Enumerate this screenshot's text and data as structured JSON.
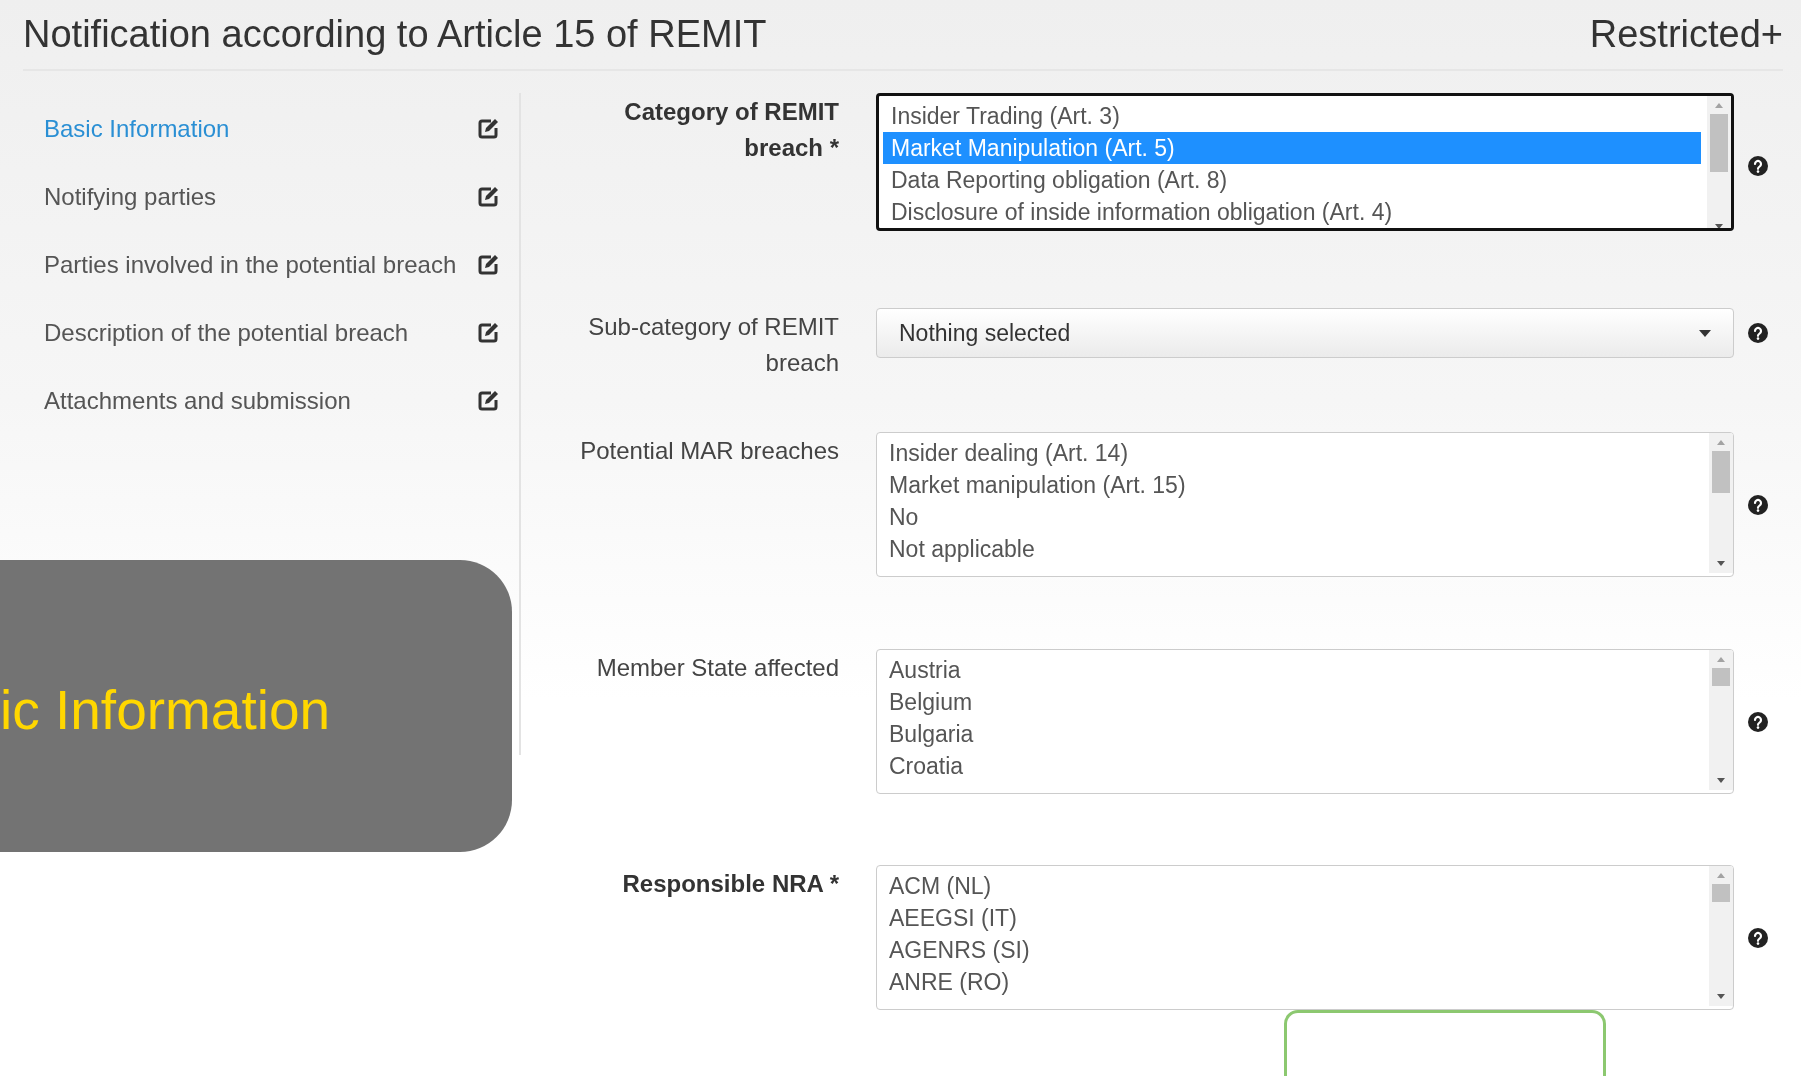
{
  "header": {
    "title": "Notification according to Article 15 of REMIT",
    "badge": "Restricted+"
  },
  "sidebar": {
    "items": [
      {
        "label": "Basic Information",
        "selected": true
      },
      {
        "label": "Notifying parties",
        "selected": false
      },
      {
        "label": "Parties involved in the potential breach",
        "selected": false
      },
      {
        "label": "Description of the potential breach",
        "selected": false
      },
      {
        "label": "Attachments and submission",
        "selected": false
      }
    ]
  },
  "form": {
    "fields": [
      {
        "kind": "listbox",
        "label": "Category of REMIT breach *",
        "required": true,
        "focused": true,
        "options": [
          {
            "label": "Insider Trading (Art. 3)",
            "selected": false
          },
          {
            "label": "Market Manipulation (Art. 5)",
            "selected": true
          },
          {
            "label": "Data Reporting obligation (Art. 8)",
            "selected": false
          },
          {
            "label": "Disclosure of inside information obligation (Art. 4)",
            "selected": false
          }
        ]
      },
      {
        "kind": "dropdown",
        "label": "Sub-category of REMIT breach",
        "required": false,
        "value": "Nothing selected"
      },
      {
        "kind": "listbox",
        "label": "Potential MAR breaches",
        "required": false,
        "focused": false,
        "options": [
          {
            "label": "Insider dealing (Art. 14)",
            "selected": false
          },
          {
            "label": "Market manipulation (Art. 15)",
            "selected": false
          },
          {
            "label": "No",
            "selected": false
          },
          {
            "label": "Not applicable",
            "selected": false
          }
        ]
      },
      {
        "kind": "listbox",
        "label": "Member State affected",
        "required": false,
        "focused": false,
        "options": [
          {
            "label": "Austria",
            "selected": false
          },
          {
            "label": "Belgium",
            "selected": false
          },
          {
            "label": "Bulgaria",
            "selected": false
          },
          {
            "label": "Croatia",
            "selected": false
          }
        ]
      },
      {
        "kind": "listbox",
        "label": "Responsible NRA *",
        "required": true,
        "focused": false,
        "options": [
          {
            "label": "ACM (NL)",
            "selected": false
          },
          {
            "label": "AEEGSI (IT)",
            "selected": false
          },
          {
            "label": "AGENRS (SI)",
            "selected": false
          },
          {
            "label": "ANRE (RO)",
            "selected": false
          }
        ]
      }
    ]
  },
  "overlay": {
    "text": "ic Information"
  }
}
